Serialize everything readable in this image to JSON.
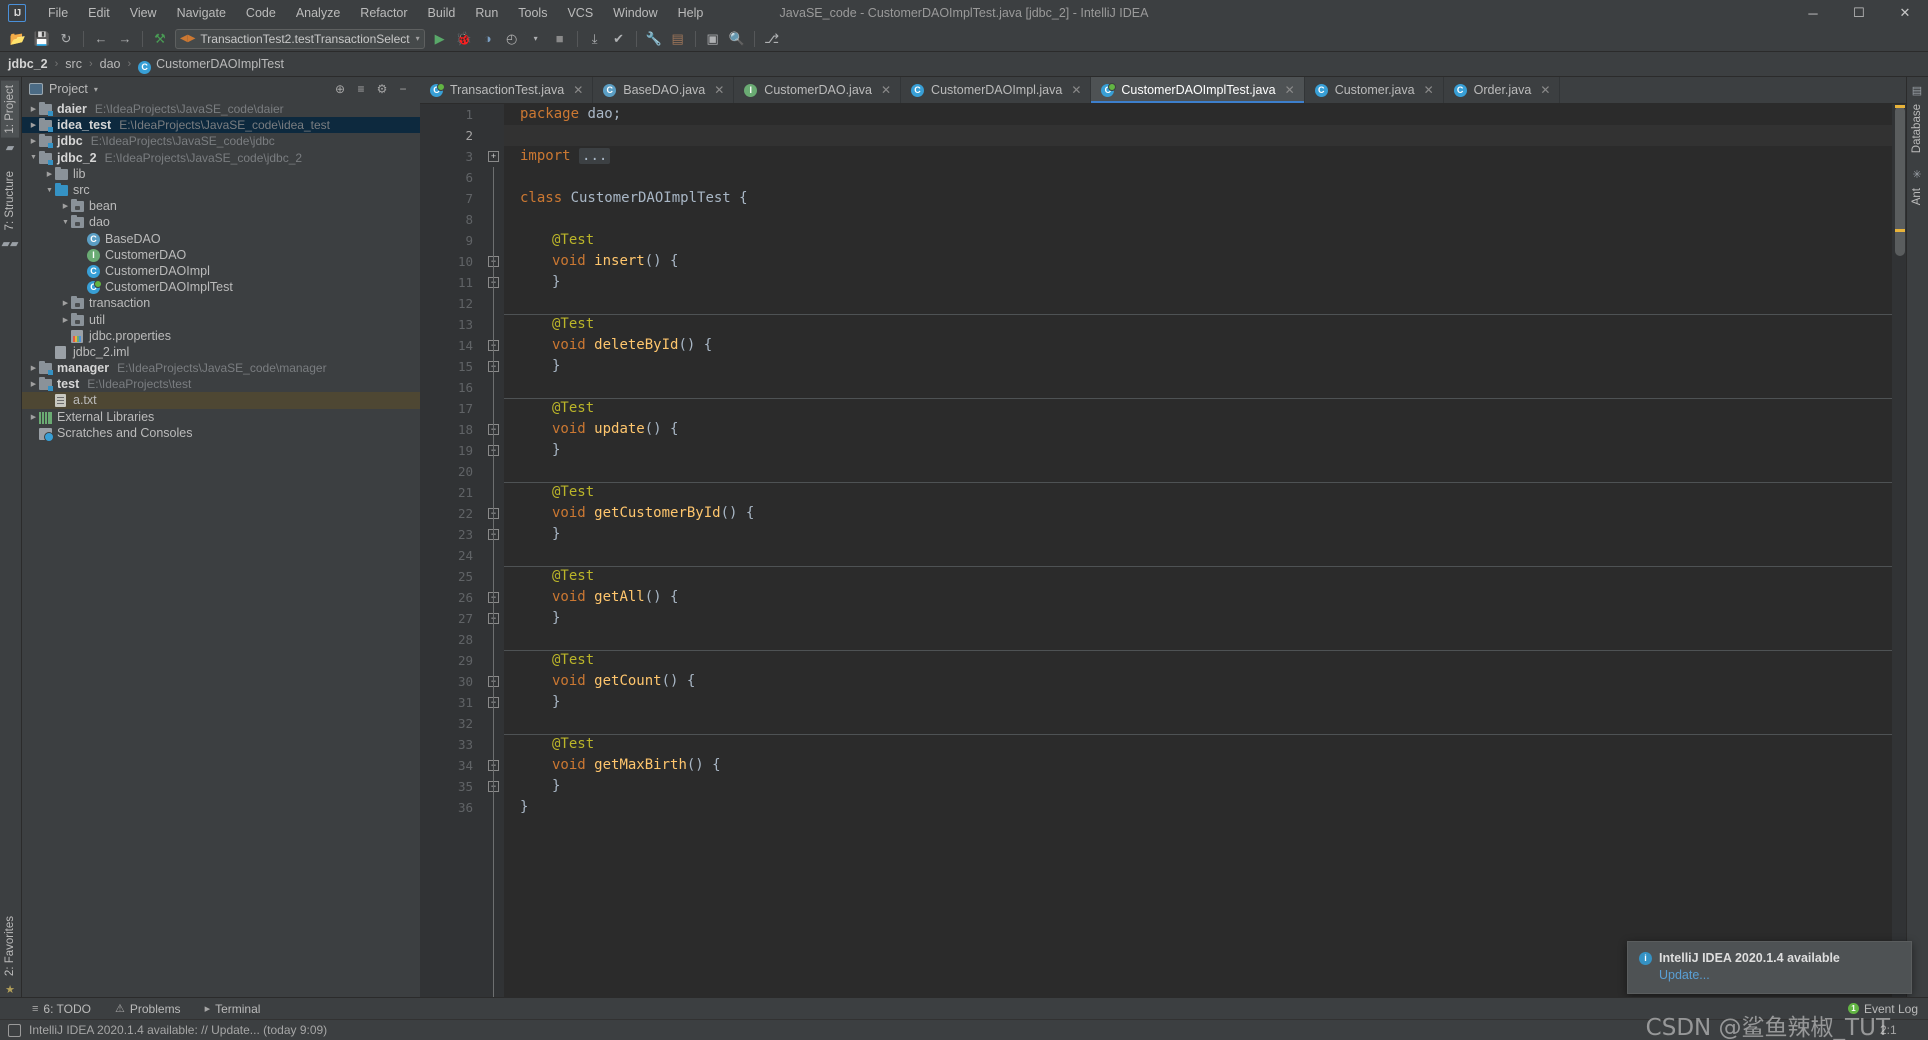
{
  "window": {
    "title": "JavaSE_code - CustomerDAOImplTest.java [jdbc_2] - IntelliJ IDEA",
    "minimize": "─",
    "maximize": "☐",
    "close": "✕",
    "logo": "IJ"
  },
  "menubar": [
    {
      "label": "File"
    },
    {
      "label": "Edit"
    },
    {
      "label": "View"
    },
    {
      "label": "Navigate"
    },
    {
      "label": "Code"
    },
    {
      "label": "Analyze"
    },
    {
      "label": "Refactor"
    },
    {
      "label": "Build"
    },
    {
      "label": "Run"
    },
    {
      "label": "Tools"
    },
    {
      "label": "VCS"
    },
    {
      "label": "Window"
    },
    {
      "label": "Help"
    }
  ],
  "toolbar": {
    "open_icon": "📂",
    "save_icon": "💾",
    "sync_icon": "↻",
    "back_icon": "←",
    "forward_icon": "→",
    "build_icon": "⚒",
    "run_config": "TransactionTest2.testTransactionSelect",
    "run_config_arrow": "▾",
    "run_icon": "▶",
    "debug_icon": "🐞",
    "coverage_icon": "◑",
    "profile_icon": "◴",
    "profile_arrow": "▾",
    "stop_icon": "■",
    "update_icon": "⤓",
    "commit_icon": "✔",
    "settings_icon": "🔧",
    "struct_icon": "▤",
    "layout_icon": "▣",
    "search_icon": "🔍",
    "searcheverywhere_icon": "⎇"
  },
  "breadcrumb": {
    "separator": "›",
    "segments": [
      {
        "label": "jdbc_2",
        "bold": true,
        "icon": null
      },
      {
        "label": "src",
        "bold": false,
        "icon": null
      },
      {
        "label": "dao",
        "bold": false,
        "icon": null
      },
      {
        "label": "CustomerDAOImplTest",
        "bold": false,
        "icon": "test-class-icon"
      }
    ]
  },
  "left_strip": {
    "top": [
      {
        "label": "1: Project",
        "selected": true
      }
    ],
    "bottom": [
      {
        "label": "2: Favorites",
        "selected": false
      }
    ],
    "structure_label": "7: Structure",
    "star_icon": "★"
  },
  "right_strip": {
    "items": [
      {
        "label": "Database"
      },
      {
        "label": "Ant"
      }
    ]
  },
  "project_panel": {
    "title": "Project",
    "dropdown_arrow": "▾",
    "actions": [
      {
        "name": "locate-icon",
        "glyph": "⊕"
      },
      {
        "name": "collapse-all-icon",
        "glyph": "≡"
      },
      {
        "name": "settings-icon",
        "glyph": "⚙"
      },
      {
        "name": "hide-icon",
        "glyph": "−"
      }
    ],
    "tree": [
      {
        "depth": 0,
        "arrow": "▶",
        "icon": "module-root",
        "name": "daier",
        "path": "E:\\IdeaProjects\\JavaSE_code\\daier",
        "bold": true,
        "state": ""
      },
      {
        "depth": 0,
        "arrow": "▶",
        "icon": "module-root",
        "name": "idea_test",
        "path": "E:\\IdeaProjects\\JavaSE_code\\idea_test",
        "bold": true,
        "state": "sel"
      },
      {
        "depth": 0,
        "arrow": "▶",
        "icon": "module-root",
        "name": "jdbc",
        "path": "E:\\IdeaProjects\\JavaSE_code\\jdbc",
        "bold": true,
        "state": ""
      },
      {
        "depth": 0,
        "arrow": "▼",
        "icon": "module-root",
        "name": "jdbc_2",
        "path": "E:\\IdeaProjects\\JavaSE_code\\jdbc_2",
        "bold": true,
        "state": ""
      },
      {
        "depth": 1,
        "arrow": "▶",
        "icon": "folder",
        "name": "lib",
        "path": "",
        "bold": false,
        "state": ""
      },
      {
        "depth": 1,
        "arrow": "▼",
        "icon": "folder-src",
        "name": "src",
        "path": "",
        "bold": false,
        "state": ""
      },
      {
        "depth": 2,
        "arrow": "▶",
        "icon": "folder-pkg",
        "name": "bean",
        "path": "",
        "bold": false,
        "state": ""
      },
      {
        "depth": 2,
        "arrow": "▼",
        "icon": "folder-pkg",
        "name": "dao",
        "path": "",
        "bold": false,
        "state": ""
      },
      {
        "depth": 3,
        "arrow": "",
        "icon": "class-abstract",
        "name": "BaseDAO",
        "path": "",
        "bold": false,
        "state": ""
      },
      {
        "depth": 3,
        "arrow": "",
        "icon": "interface",
        "name": "CustomerDAO",
        "path": "",
        "bold": false,
        "state": ""
      },
      {
        "depth": 3,
        "arrow": "",
        "icon": "class",
        "name": "CustomerDAOImpl",
        "path": "",
        "bold": false,
        "state": ""
      },
      {
        "depth": 3,
        "arrow": "",
        "icon": "class-test",
        "name": "CustomerDAOImplTest",
        "path": "",
        "bold": false,
        "state": ""
      },
      {
        "depth": 2,
        "arrow": "▶",
        "icon": "folder-pkg",
        "name": "transaction",
        "path": "",
        "bold": false,
        "state": ""
      },
      {
        "depth": 2,
        "arrow": "▶",
        "icon": "folder-pkg",
        "name": "util",
        "path": "",
        "bold": false,
        "state": ""
      },
      {
        "depth": 2,
        "arrow": "",
        "icon": "properties",
        "name": "jdbc.properties",
        "path": "",
        "bold": false,
        "state": ""
      },
      {
        "depth": 1,
        "arrow": "",
        "icon": "iml",
        "name": "jdbc_2.iml",
        "path": "",
        "bold": false,
        "state": ""
      },
      {
        "depth": 0,
        "arrow": "▶",
        "icon": "module-root",
        "name": "manager",
        "path": "E:\\IdeaProjects\\JavaSE_code\\manager",
        "bold": true,
        "state": ""
      },
      {
        "depth": 0,
        "arrow": "▶",
        "icon": "module-root",
        "name": "test",
        "path": "E:\\IdeaProjects\\test",
        "bold": true,
        "state": ""
      },
      {
        "depth": 1,
        "arrow": "",
        "icon": "txt",
        "name": "a.txt",
        "path": "",
        "bold": false,
        "state": "sel2"
      },
      {
        "depth": 0,
        "arrow": "▶",
        "icon": "library",
        "name": "External Libraries",
        "path": "",
        "bold": false,
        "state": ""
      },
      {
        "depth": 0,
        "arrow": "",
        "icon": "scratch",
        "name": "Scratches and Consoles",
        "path": "",
        "bold": false,
        "state": ""
      }
    ]
  },
  "editor": {
    "tabs": [
      {
        "label": "TransactionTest.java",
        "icon": "class-test",
        "active": false,
        "close": "✕"
      },
      {
        "label": "BaseDAO.java",
        "icon": "class-abstract",
        "active": false,
        "close": "✕"
      },
      {
        "label": "CustomerDAO.java",
        "icon": "interface",
        "active": false,
        "close": "✕"
      },
      {
        "label": "CustomerDAOImpl.java",
        "icon": "class",
        "active": false,
        "close": "✕"
      },
      {
        "label": "CustomerDAOImplTest.java",
        "icon": "class-test",
        "active": true,
        "close": "✕"
      },
      {
        "label": "Customer.java",
        "icon": "class",
        "active": false,
        "close": "✕"
      },
      {
        "label": "Order.java",
        "icon": "class",
        "active": false,
        "close": "✕"
      }
    ],
    "lines": [
      {
        "num": "1",
        "indent": 0,
        "tokens": [
          {
            "t": "package ",
            "c": "kw"
          },
          {
            "t": "dao;",
            "c": "pl"
          }
        ],
        "run": "",
        "fold": "",
        "sep": false
      },
      {
        "num": "2",
        "indent": 0,
        "tokens": [],
        "run": "",
        "fold": "",
        "sep": false
      },
      {
        "num": "3",
        "indent": 0,
        "tokens": [
          {
            "t": "import ",
            "c": "kw"
          },
          {
            "t": "...",
            "c": "ph"
          }
        ],
        "run": "",
        "fold": "plus",
        "sep": false
      },
      {
        "num": "6",
        "indent": 0,
        "tokens": [],
        "run": "",
        "fold": "",
        "sep": false
      },
      {
        "num": "7",
        "indent": 0,
        "tokens": [
          {
            "t": "class ",
            "c": "kw"
          },
          {
            "t": "CustomerDAOImplTest",
            "c": "cls"
          },
          {
            "t": " {",
            "c": "pl"
          }
        ],
        "run": "double",
        "fold": "",
        "sep": false
      },
      {
        "num": "8",
        "indent": 0,
        "tokens": [],
        "run": "",
        "fold": "",
        "sep": false
      },
      {
        "num": "9",
        "indent": 1,
        "tokens": [
          {
            "t": "@Test",
            "c": "ann"
          }
        ],
        "run": "",
        "fold": "",
        "sep": false
      },
      {
        "num": "10",
        "indent": 1,
        "tokens": [
          {
            "t": "void ",
            "c": "kw"
          },
          {
            "t": "insert",
            "c": "mth"
          },
          {
            "t": "() {",
            "c": "pl"
          }
        ],
        "run": "single",
        "fold": "minus-top",
        "sep": false
      },
      {
        "num": "11",
        "indent": 1,
        "tokens": [
          {
            "t": "}",
            "c": "pl"
          }
        ],
        "run": "",
        "fold": "minus-bot",
        "sep": false
      },
      {
        "num": "12",
        "indent": 0,
        "tokens": [],
        "run": "",
        "fold": "",
        "sep": false
      },
      {
        "num": "13",
        "indent": 1,
        "tokens": [
          {
            "t": "@Test",
            "c": "ann"
          }
        ],
        "run": "",
        "fold": "",
        "sep": true
      },
      {
        "num": "14",
        "indent": 1,
        "tokens": [
          {
            "t": "void ",
            "c": "kw"
          },
          {
            "t": "deleteById",
            "c": "mth"
          },
          {
            "t": "() {",
            "c": "pl"
          }
        ],
        "run": "single",
        "fold": "minus-top",
        "sep": false
      },
      {
        "num": "15",
        "indent": 1,
        "tokens": [
          {
            "t": "}",
            "c": "pl"
          }
        ],
        "run": "",
        "fold": "minus-bot",
        "sep": false
      },
      {
        "num": "16",
        "indent": 0,
        "tokens": [],
        "run": "",
        "fold": "",
        "sep": false
      },
      {
        "num": "17",
        "indent": 1,
        "tokens": [
          {
            "t": "@Test",
            "c": "ann"
          }
        ],
        "run": "",
        "fold": "",
        "sep": true
      },
      {
        "num": "18",
        "indent": 1,
        "tokens": [
          {
            "t": "void ",
            "c": "kw"
          },
          {
            "t": "update",
            "c": "mth"
          },
          {
            "t": "() {",
            "c": "pl"
          }
        ],
        "run": "single",
        "fold": "minus-top",
        "sep": false
      },
      {
        "num": "19",
        "indent": 1,
        "tokens": [
          {
            "t": "}",
            "c": "pl"
          }
        ],
        "run": "",
        "fold": "minus-bot",
        "sep": false
      },
      {
        "num": "20",
        "indent": 0,
        "tokens": [],
        "run": "",
        "fold": "",
        "sep": false
      },
      {
        "num": "21",
        "indent": 1,
        "tokens": [
          {
            "t": "@Test",
            "c": "ann"
          }
        ],
        "run": "",
        "fold": "",
        "sep": true
      },
      {
        "num": "22",
        "indent": 1,
        "tokens": [
          {
            "t": "void ",
            "c": "kw"
          },
          {
            "t": "getCustomerById",
            "c": "mth"
          },
          {
            "t": "() {",
            "c": "pl"
          }
        ],
        "run": "single",
        "fold": "minus-top",
        "sep": false
      },
      {
        "num": "23",
        "indent": 1,
        "tokens": [
          {
            "t": "}",
            "c": "pl"
          }
        ],
        "run": "",
        "fold": "minus-bot",
        "sep": false
      },
      {
        "num": "24",
        "indent": 0,
        "tokens": [],
        "run": "",
        "fold": "",
        "sep": false
      },
      {
        "num": "25",
        "indent": 1,
        "tokens": [
          {
            "t": "@Test",
            "c": "ann"
          }
        ],
        "run": "",
        "fold": "",
        "sep": true
      },
      {
        "num": "26",
        "indent": 1,
        "tokens": [
          {
            "t": "void ",
            "c": "kw"
          },
          {
            "t": "getAll",
            "c": "mth"
          },
          {
            "t": "() {",
            "c": "pl"
          }
        ],
        "run": "single",
        "fold": "minus-top",
        "sep": false
      },
      {
        "num": "27",
        "indent": 1,
        "tokens": [
          {
            "t": "}",
            "c": "pl"
          }
        ],
        "run": "",
        "fold": "minus-bot",
        "sep": false
      },
      {
        "num": "28",
        "indent": 0,
        "tokens": [],
        "run": "",
        "fold": "",
        "sep": false
      },
      {
        "num": "29",
        "indent": 1,
        "tokens": [
          {
            "t": "@Test",
            "c": "ann"
          }
        ],
        "run": "",
        "fold": "",
        "sep": true
      },
      {
        "num": "30",
        "indent": 1,
        "tokens": [
          {
            "t": "void ",
            "c": "kw"
          },
          {
            "t": "getCount",
            "c": "mth"
          },
          {
            "t": "() {",
            "c": "pl"
          }
        ],
        "run": "single",
        "fold": "minus-top",
        "sep": false
      },
      {
        "num": "31",
        "indent": 1,
        "tokens": [
          {
            "t": "}",
            "c": "pl"
          }
        ],
        "run": "",
        "fold": "minus-bot",
        "sep": false
      },
      {
        "num": "32",
        "indent": 0,
        "tokens": [],
        "run": "",
        "fold": "",
        "sep": false
      },
      {
        "num": "33",
        "indent": 1,
        "tokens": [
          {
            "t": "@Test",
            "c": "ann"
          }
        ],
        "run": "",
        "fold": "",
        "sep": true
      },
      {
        "num": "34",
        "indent": 1,
        "tokens": [
          {
            "t": "void ",
            "c": "kw"
          },
          {
            "t": "getMaxBirth",
            "c": "mth"
          },
          {
            "t": "() {",
            "c": "pl"
          }
        ],
        "run": "single",
        "fold": "minus-top",
        "sep": false
      },
      {
        "num": "35",
        "indent": 1,
        "tokens": [
          {
            "t": "}",
            "c": "pl"
          }
        ],
        "run": "",
        "fold": "minus-bot",
        "sep": false
      },
      {
        "num": "36",
        "indent": 0,
        "tokens": [
          {
            "t": "}",
            "c": "pl"
          }
        ],
        "run": "",
        "fold": "",
        "sep": false
      }
    ]
  },
  "bottom_bar": {
    "items": [
      {
        "label": "6: TODO",
        "icon": "≡"
      },
      {
        "label": "Problems",
        "icon": "⚠"
      },
      {
        "label": "Terminal",
        "icon": "▸"
      }
    ],
    "event_log": "Event Log",
    "event_log_badge": "1"
  },
  "status_bar": {
    "message": "IntelliJ IDEA 2020.1.4 available: // Update... (today 9:09)",
    "caret": "2:1"
  },
  "notification": {
    "title": "IntelliJ IDEA 2020.1.4 available",
    "link": "Update...",
    "icon": "i"
  },
  "watermark": "CSDN @鲨鱼辣椒_TUT",
  "colors": {
    "accent": "#3d7fcc",
    "keyword": "#cc7832",
    "annotation": "#bbb529",
    "method": "#ffc66d",
    "plain": "#a9b7c6",
    "editor_bg": "#2b2b2b",
    "chrome_bg": "#3c3f41",
    "selection": "#0d293e"
  }
}
